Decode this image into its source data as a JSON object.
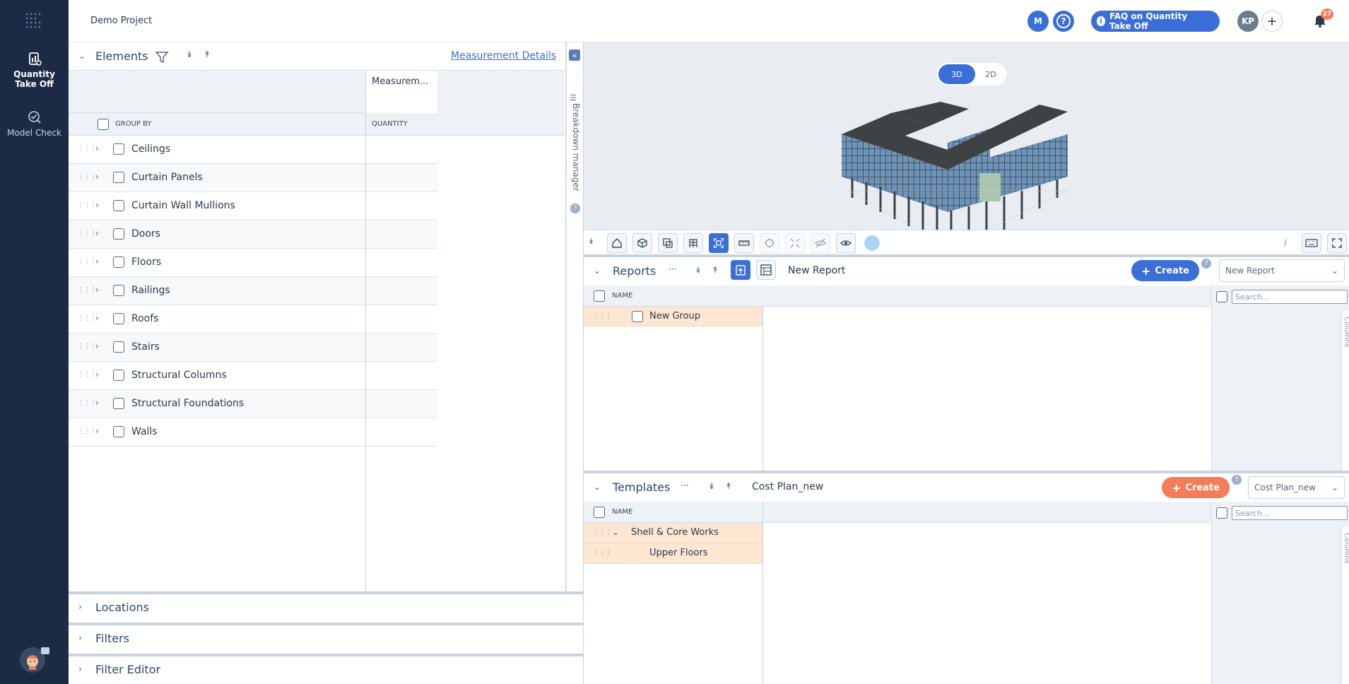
{
  "header": {
    "project_title": "Demo Project",
    "avatar_m": "M",
    "help": "?",
    "faq_label": "FAQ on Quantity Take Off",
    "avatar_kp": "KP",
    "add": "+",
    "notification_count": "27"
  },
  "sidebar": {
    "items": [
      {
        "label_line1": "Quantity",
        "label_line2": "Take Off"
      },
      {
        "label": "Model Check"
      }
    ]
  },
  "elements": {
    "title": "Elements",
    "measurement_details": "Measurement Details",
    "col_measurement": "Measurem...",
    "col_group_by": "GROUP BY",
    "col_quantity": "QUANTITY",
    "rows": [
      "Ceilings",
      "Curtain Panels",
      "Curtain Wall Mullions",
      "Doors",
      "Floors",
      "Railings",
      "Roofs",
      "Stairs",
      "Structural Columns",
      "Structural Foundations",
      "Walls"
    ]
  },
  "breakdown_manager": "Breakdown manager",
  "collapsed_panels": [
    "Locations",
    "Filters",
    "Filter Editor"
  ],
  "viewer": {
    "toggle_3d": "3D",
    "toggle_2d": "2D"
  },
  "reports": {
    "title": "Reports",
    "more": "···",
    "current": "New Report",
    "create_label": "Create",
    "select_value": "New Report",
    "col_name": "NAME",
    "search_placeholder": "Search...",
    "rows": [
      "New Group"
    ],
    "columns_tab": "Columns"
  },
  "templates": {
    "title": "Templates",
    "more": "···",
    "current": "Cost Plan_new",
    "create_label": "Create",
    "select_value": "Cost Plan_new",
    "col_name": "NAME",
    "search_placeholder": "Search...",
    "rows": [
      "Shell & Core Works",
      "Upper Floors"
    ],
    "columns_tab": "Columns"
  },
  "colors": {
    "sidebar": "#1c2b45",
    "accent": "#3b6fd8",
    "create_template": "#f47c58",
    "row_highlight": "#fde6d2"
  }
}
